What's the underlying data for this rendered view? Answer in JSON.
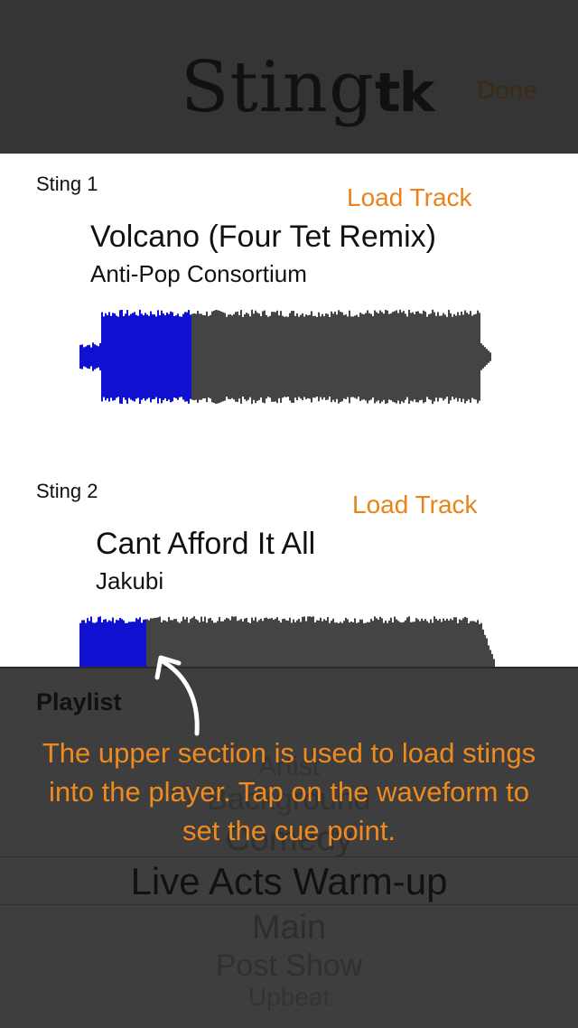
{
  "header": {
    "logo_main": "Sting",
    "logo_tk": "tk",
    "done_label": "Done"
  },
  "stings": [
    {
      "label": "Sting 1",
      "load_label": "Load Track",
      "title": "Volcano (Four Tet Remix)",
      "artist": "Anti-Pop Consortium",
      "played_fraction": 0.27
    },
    {
      "label": "Sting 2",
      "load_label": "Load Track",
      "title": "Cant Afford It All",
      "artist": "Jakubi",
      "played_fraction": 0.16
    }
  ],
  "playlist": {
    "label": "Playlist",
    "items": [
      "Artist",
      "Background",
      "Comedy"
    ],
    "selected": "Live Acts Warm-up",
    "items_after": [
      "Main",
      "Post Show",
      "Upbeat"
    ]
  },
  "tooltip": {
    "text": "The upper section is used to load stings into the player. Tap on the waveform to set the cue point."
  },
  "colors": {
    "accent": "#e8831c",
    "waveform_played": "#1010d0",
    "waveform_unplayed": "#444444"
  }
}
